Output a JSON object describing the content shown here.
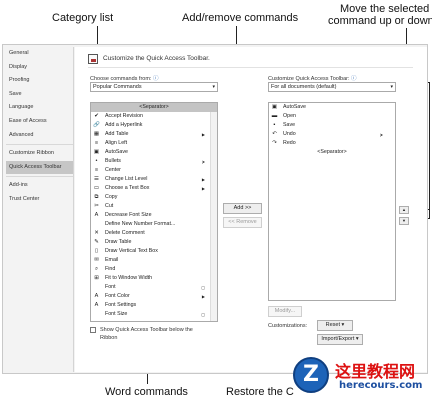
{
  "callouts": {
    "category_list": "Category list",
    "add_remove": "Add/remove commands",
    "move_line1": "Move the selected",
    "move_line2": "command up or down",
    "word_commands": "Word commands",
    "restore": "Restore the C"
  },
  "nav": {
    "items": [
      "General",
      "Display",
      "Proofing",
      "Save",
      "Language",
      "Ease of Access",
      "Advanced",
      "Customize Ribbon",
      "Quick Access Toolbar",
      "Add-ins",
      "Trust Center"
    ],
    "selected": "Quick Access Toolbar"
  },
  "header": {
    "title": "Customize the Quick Access Toolbar."
  },
  "choose": {
    "label": "Choose commands from:",
    "value": "Popular Commands",
    "items": [
      {
        "label": "<Separator>",
        "icon": "",
        "selected": true
      },
      {
        "label": "Accept Revision",
        "icon": "✔"
      },
      {
        "label": "Add a Hyperlink",
        "icon": "🔗"
      },
      {
        "label": "Add Table",
        "icon": "▦",
        "sub": "▶"
      },
      {
        "label": "Align Left",
        "icon": "≡"
      },
      {
        "label": "AutoSave",
        "icon": "▣"
      },
      {
        "label": "Bullets",
        "icon": "•",
        "sub": "|▸"
      },
      {
        "label": "Center",
        "icon": "≡"
      },
      {
        "label": "Change List Level",
        "icon": "☰",
        "sub": "▶"
      },
      {
        "label": "Choose a Text Box",
        "icon": "▭",
        "sub": "▶"
      },
      {
        "label": "Copy",
        "icon": "⧉"
      },
      {
        "label": "Cut",
        "icon": "✂"
      },
      {
        "label": "Decrease Font Size",
        "icon": "A"
      },
      {
        "label": "Define New Number Format...",
        "icon": ""
      },
      {
        "label": "Delete Comment",
        "icon": "✕"
      },
      {
        "label": "Draw Table",
        "icon": "✎"
      },
      {
        "label": "Draw Vertical Text Box",
        "icon": "▯"
      },
      {
        "label": "Email",
        "icon": "✉"
      },
      {
        "label": "Find",
        "icon": "⌕"
      },
      {
        "label": "Fit to Window Width",
        "icon": "⊞"
      },
      {
        "label": "Font",
        "icon": "",
        "sub": "▢"
      },
      {
        "label": "Font Color",
        "icon": "A",
        "sub": "▶"
      },
      {
        "label": "Font Settings",
        "icon": "A"
      },
      {
        "label": "Font Size",
        "icon": "",
        "sub": "▢"
      }
    ]
  },
  "customize": {
    "label": "Customize Quick Access Toolbar:",
    "value": "For all documents (default)",
    "items": [
      {
        "label": "AutoSave",
        "icon": "▣"
      },
      {
        "label": "Open",
        "icon": "▬"
      },
      {
        "label": "Save",
        "icon": "▪"
      },
      {
        "label": "Undo",
        "icon": "↶",
        "sub": "|▸"
      },
      {
        "label": "Redo",
        "icon": "↷"
      },
      {
        "label": "<Separator>",
        "icon": ""
      }
    ]
  },
  "buttons": {
    "add": "Add >>",
    "remove": "<< Remove",
    "modify": "Modify...",
    "reset": "Reset ▾",
    "import_export": "Import/Export ▾",
    "move_up": "▲",
    "move_down": "▼"
  },
  "show_below": {
    "line1": "Show Quick Access Toolbar below the",
    "line2": "Ribbon"
  },
  "customizations_label": "Customizations:",
  "watermark": {
    "logo_letter": "Z",
    "title": "这里教程网",
    "url": "herecours.com"
  }
}
